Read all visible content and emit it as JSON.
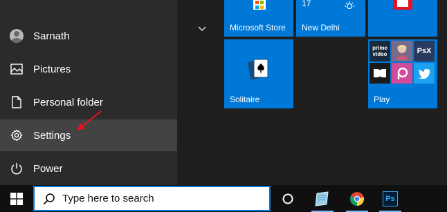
{
  "start_menu": {
    "items": [
      {
        "label": "Sarnath",
        "icon": "user-avatar-icon"
      },
      {
        "label": "Pictures",
        "icon": "pictures-icon"
      },
      {
        "label": "Personal folder",
        "icon": "document-icon"
      },
      {
        "label": "Settings",
        "icon": "gear-icon"
      },
      {
        "label": "Power",
        "icon": "power-icon"
      }
    ]
  },
  "tiles": {
    "store": {
      "label": "Microsoft Store"
    },
    "weather": {
      "label": "New Delhi",
      "temp": "17"
    },
    "solitaire": {
      "label": "Solitaire"
    },
    "play": {
      "label": "Play",
      "apps": [
        "prime video",
        "PsX",
        "Dolby",
        "PicsArt",
        "Twitter"
      ]
    }
  },
  "taskbar": {
    "search_placeholder": "Type here to search",
    "ps_label": "Ps"
  },
  "colors": {
    "accent": "#0078d7",
    "annotation_arrow": "#e81123"
  }
}
